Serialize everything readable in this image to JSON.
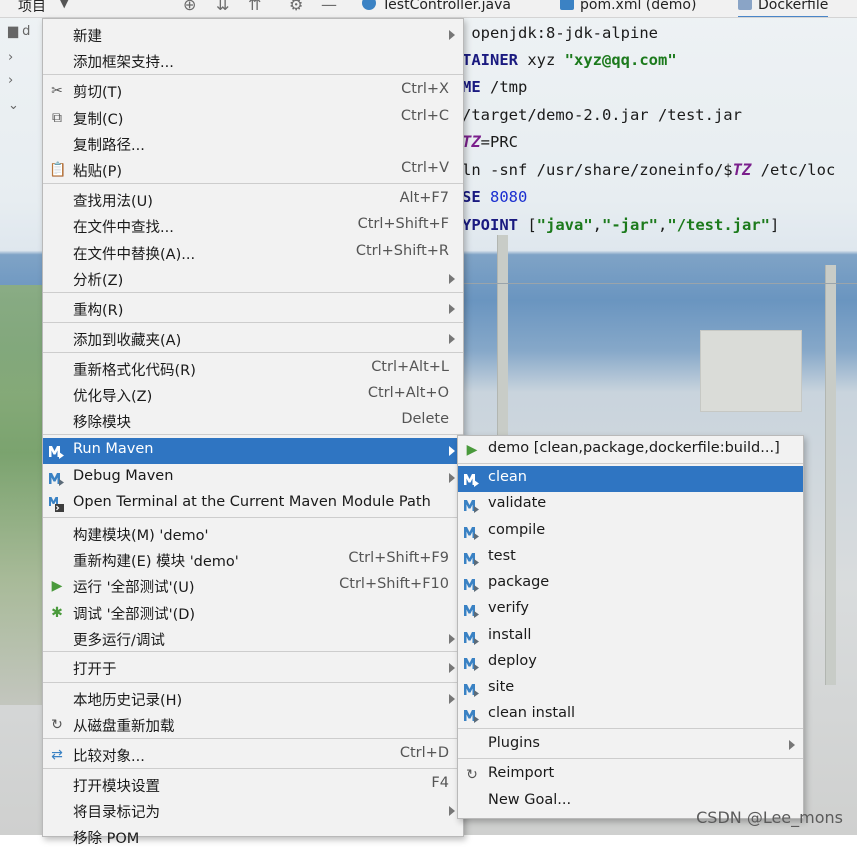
{
  "toolbar": {
    "project_label": "项目",
    "tabs": [
      {
        "label": "TestController.java"
      },
      {
        "label": "pom.xml (demo)"
      },
      {
        "label": "Dockerfile"
      }
    ],
    "tree_label": "d"
  },
  "editor": {
    "lines": [
      {
        "a": "",
        "kw": "",
        "b": "openjdk:8-jdk-alpine"
      },
      {
        "kw": "TAINER",
        "b": " xyz ",
        "s": "\"xyz@qq.com\""
      },
      {
        "kw": "ME",
        "b": " /tmp"
      },
      {
        "b": "/target/demo-2.0.jar /test.jar"
      },
      {
        "v": "TZ",
        "b": "=PRC"
      },
      {
        "b": "ln -snf /usr/share/zoneinfo/$",
        "v": "TZ",
        "c": " /etc/loc"
      },
      {
        "kw": "SE",
        "n": " 8080"
      },
      {
        "kw": "YPOINT",
        "b": " [",
        "s": "\"java\"",
        "b2": ",",
        "s2": "\"-jar\"",
        "b3": ",",
        "s3": "\"/test.jar\"",
        "b4": "]"
      }
    ]
  },
  "menu": {
    "items": [
      {
        "label": "新建",
        "shortcut": "",
        "submenu": true,
        "icon": ""
      },
      {
        "label": "添加框架支持...",
        "shortcut": "",
        "submenu": false,
        "icon": ""
      },
      {
        "label": "剪切(T)",
        "shortcut": "Ctrl+X",
        "submenu": false,
        "icon": "scissors-icon"
      },
      {
        "label": "复制(C)",
        "shortcut": "Ctrl+C",
        "submenu": false,
        "icon": "copy-icon"
      },
      {
        "label": "复制路径...",
        "shortcut": "",
        "submenu": false,
        "icon": ""
      },
      {
        "label": "粘贴(P)",
        "shortcut": "Ctrl+V",
        "submenu": false,
        "icon": "paste-icon"
      },
      {
        "label": "查找用法(U)",
        "shortcut": "Alt+F7",
        "submenu": false,
        "icon": ""
      },
      {
        "label": "在文件中查找...",
        "shortcut": "Ctrl+Shift+F",
        "submenu": false,
        "icon": ""
      },
      {
        "label": "在文件中替换(A)...",
        "shortcut": "Ctrl+Shift+R",
        "submenu": false,
        "icon": ""
      },
      {
        "label": "分析(Z)",
        "shortcut": "",
        "submenu": true,
        "icon": ""
      },
      {
        "label": "重构(R)",
        "shortcut": "",
        "submenu": true,
        "icon": ""
      },
      {
        "label": "添加到收藏夹(A)",
        "shortcut": "",
        "submenu": true,
        "icon": ""
      },
      {
        "label": "重新格式化代码(R)",
        "shortcut": "Ctrl+Alt+L",
        "submenu": false,
        "icon": ""
      },
      {
        "label": "优化导入(Z)",
        "shortcut": "Ctrl+Alt+O",
        "submenu": false,
        "icon": ""
      },
      {
        "label": "移除模块",
        "shortcut": "Delete",
        "submenu": false,
        "icon": ""
      },
      {
        "label": "Run Maven",
        "shortcut": "",
        "submenu": true,
        "icon": "maven-icon"
      },
      {
        "label": "Debug Maven",
        "shortcut": "",
        "submenu": true,
        "icon": "maven-icon"
      },
      {
        "label": "Open Terminal at the Current Maven Module Path",
        "shortcut": "",
        "submenu": false,
        "icon": "maven-terminal-icon"
      },
      {
        "label": "构建模块(M) 'demo'",
        "shortcut": "",
        "submenu": false,
        "icon": ""
      },
      {
        "label": "重新构建(E) 模块 'demo'",
        "shortcut": "Ctrl+Shift+F9",
        "submenu": false,
        "icon": ""
      },
      {
        "label": "运行 '全部测试'(U)",
        "shortcut": "Ctrl+Shift+F10",
        "submenu": false,
        "icon": "run-icon"
      },
      {
        "label": "调试 '全部测试'(D)",
        "shortcut": "",
        "submenu": false,
        "icon": "debug-icon"
      },
      {
        "label": "更多运行/调试",
        "shortcut": "",
        "submenu": true,
        "icon": ""
      },
      {
        "label": "打开于",
        "shortcut": "",
        "submenu": true,
        "icon": ""
      },
      {
        "label": "本地历史记录(H)",
        "shortcut": "",
        "submenu": true,
        "icon": ""
      },
      {
        "label": "从磁盘重新加载",
        "shortcut": "",
        "submenu": false,
        "icon": "reload-icon"
      },
      {
        "label": "比较对象...",
        "shortcut": "Ctrl+D",
        "submenu": false,
        "icon": "compare-icon"
      },
      {
        "label": "打开模块设置",
        "shortcut": "F4",
        "submenu": false,
        "icon": ""
      },
      {
        "label": "将目录标记为",
        "shortcut": "",
        "submenu": true,
        "icon": ""
      },
      {
        "label": "移除 POM",
        "shortcut": "",
        "submenu": false,
        "icon": ""
      }
    ],
    "highlighted": "Run Maven"
  },
  "submenu": {
    "items": [
      {
        "label": "demo [clean,package,dockerfile:build...]",
        "icon": "run-icon",
        "submenu": false
      },
      {
        "label": "clean",
        "icon": "maven-goal-icon",
        "submenu": false
      },
      {
        "label": "validate",
        "icon": "maven-goal-icon",
        "submenu": false
      },
      {
        "label": "compile",
        "icon": "maven-goal-icon",
        "submenu": false
      },
      {
        "label": "test",
        "icon": "maven-goal-icon",
        "submenu": false
      },
      {
        "label": "package",
        "icon": "maven-goal-icon",
        "submenu": false
      },
      {
        "label": "verify",
        "icon": "maven-goal-icon",
        "submenu": false
      },
      {
        "label": "install",
        "icon": "maven-goal-icon",
        "submenu": false
      },
      {
        "label": "deploy",
        "icon": "maven-goal-icon",
        "submenu": false
      },
      {
        "label": "site",
        "icon": "maven-goal-icon",
        "submenu": false
      },
      {
        "label": "clean install",
        "icon": "maven-goal-icon",
        "submenu": false
      },
      {
        "label": "Plugins",
        "icon": "",
        "submenu": true
      },
      {
        "label": "Reimport",
        "icon": "reload-icon",
        "submenu": false
      },
      {
        "label": "New Goal...",
        "icon": "",
        "submenu": false
      }
    ],
    "highlighted": "clean"
  },
  "watermark": "CSDN @Lee_mons",
  "colors": {
    "highlight": "#2f75c2",
    "menu_bg": "#f2f2f2",
    "maven_blue": "#3a82c4"
  }
}
